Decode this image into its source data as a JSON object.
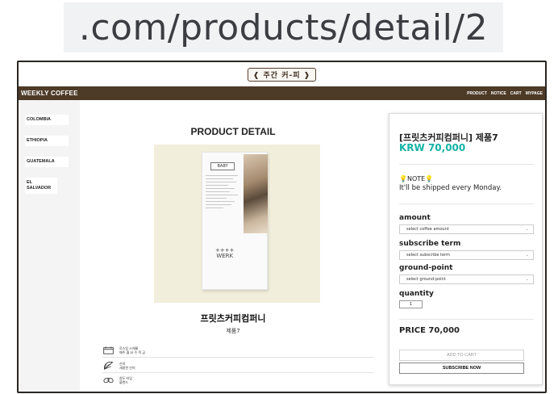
{
  "browser": {
    "url_fragment": ".com/products/detail/2"
  },
  "header": {
    "logo": "주간 커-피",
    "brand": "WEEKLY COFFEE",
    "menu": [
      "PRODUCT",
      "NOTICE",
      "CART",
      "MYPAGE"
    ]
  },
  "sidebar": {
    "items": [
      {
        "label": "COLOMBIA"
      },
      {
        "label": "ETHIOPIA"
      },
      {
        "label": "GUATEMALA"
      },
      {
        "label": "EL SALVADOR"
      }
    ]
  },
  "main": {
    "title": "PRODUCT DETAIL",
    "image": {
      "bag_label": "BABY",
      "bag_brand_mark": "++++",
      "bag_brand": "WERK"
    },
    "product_name": "프릿츠커피컴퍼니",
    "product_sub": "제품7",
    "features": [
      {
        "icon": "calendar-icon",
        "line1": "로스팅 스케쥴",
        "line2": "매주 월 요 수 목 금"
      },
      {
        "icon": "citrus-icon",
        "line1": "산미",
        "line2": "새콤한 산미"
      },
      {
        "icon": "bean-icon",
        "line1": "원두 타입",
        "line2": "블렌드"
      }
    ]
  },
  "panel": {
    "title": "[프릿츠커피컴퍼니] 제품7",
    "price": "KRW 70,000",
    "note_label": "NOTE",
    "note_icon": "lightbulb-icon",
    "shipping_note": "It'll be shipped every Monday.",
    "amount_label": "amount",
    "amount_select": "select coffee amount",
    "term_label": "subscribe term",
    "term_select": "select subscribe term",
    "ground_label": "ground-point",
    "ground_select": "select ground-point",
    "quantity_label": "quantity",
    "quantity_value": "1",
    "total_price": "PRICE 70,000",
    "add_to_cart": "ADD TO CART",
    "subscribe_now": "SUBSCRIBE NOW",
    "accent_color": "#13b3a6"
  },
  "colors": {
    "nav_bg": "#4d3a27",
    "image_bg": "#f2eedc"
  }
}
